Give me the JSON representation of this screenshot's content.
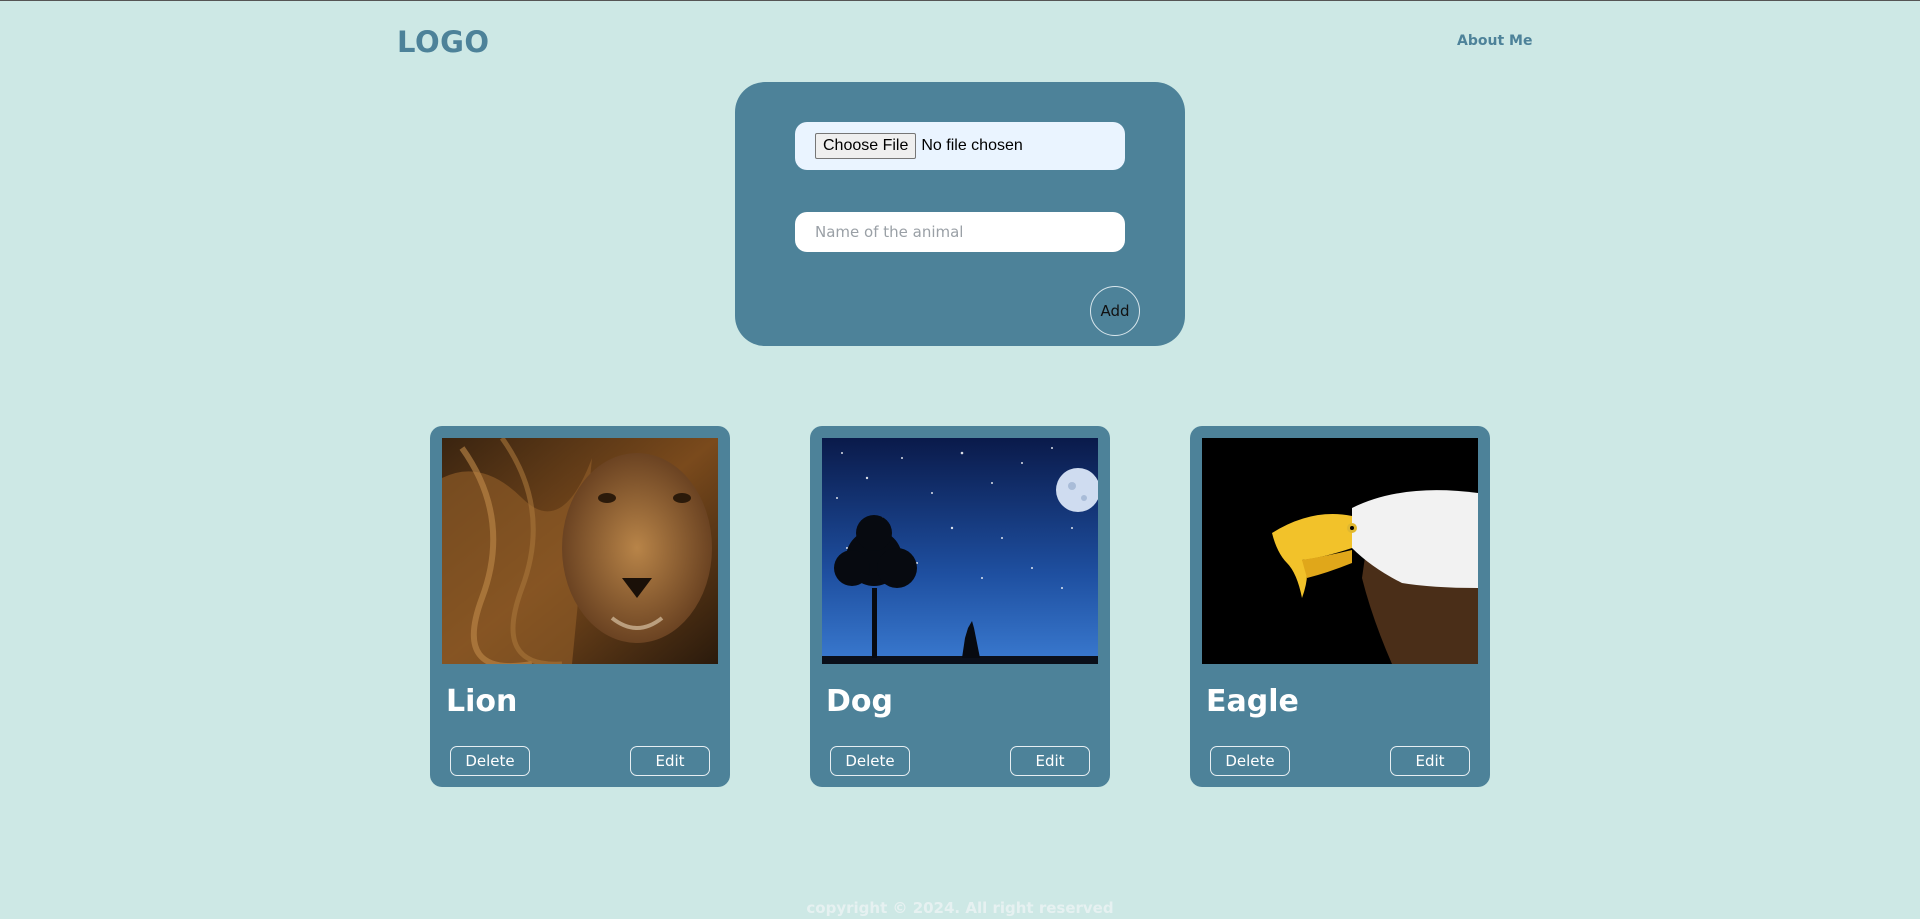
{
  "header": {
    "logo": "LOGO",
    "nav_about": "About Me"
  },
  "form": {
    "file_button_label": "Choose File",
    "file_status": "No file chosen",
    "name_placeholder": "Name of the animal",
    "add_label": "Add"
  },
  "cards": [
    {
      "title": "Lion",
      "delete_label": "Delete",
      "edit_label": "Edit"
    },
    {
      "title": "Dog",
      "delete_label": "Delete",
      "edit_label": "Edit"
    },
    {
      "title": "Eagle",
      "delete_label": "Delete",
      "edit_label": "Edit"
    }
  ],
  "footer": {
    "copyright": "copyright © 2024. All right reserved"
  },
  "colors": {
    "background": "#cde8e5",
    "accent": "#4d8299"
  }
}
